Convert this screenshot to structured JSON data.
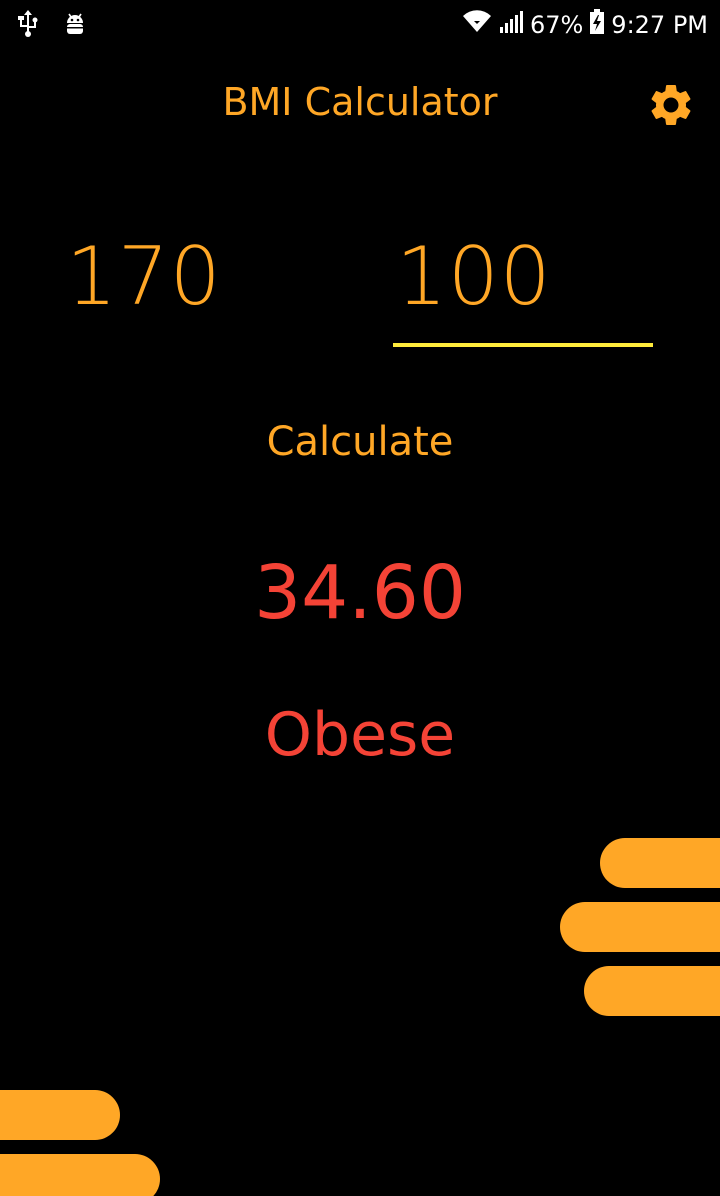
{
  "status_bar": {
    "battery": "67%",
    "time": "9:27 PM",
    "icons": [
      "usb-icon",
      "android-debug-icon",
      "wifi-icon",
      "signal-icon",
      "battery-charging-icon"
    ]
  },
  "app": {
    "title": "BMI Calculator",
    "settings_icon": "gear-icon"
  },
  "form": {
    "height_value": "170",
    "weight_value": "100",
    "calculate_label": "Calculate"
  },
  "result": {
    "bmi": "34.60",
    "category": "Obese"
  },
  "colors": {
    "accent": "#FFA726",
    "underline": "#FFEB3B",
    "result": "#F44336",
    "background": "#000000"
  }
}
